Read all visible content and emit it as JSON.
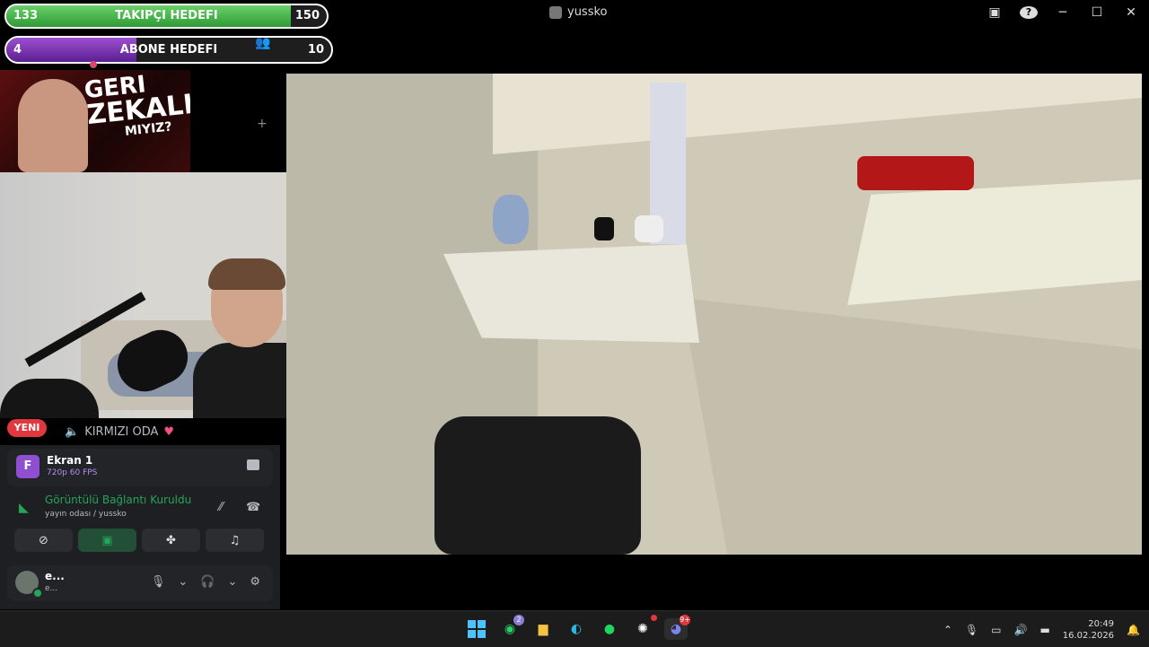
{
  "goals": {
    "followers": {
      "start": "133",
      "title": "TAKIPÇI HEDEFI",
      "end": "150",
      "progress": 0.887
    },
    "subs": {
      "start": "4",
      "title": "ABONE HEDEFI",
      "end": "10",
      "progress": 0.4
    }
  },
  "titlebar": {
    "username": "yussko"
  },
  "thumbnail": {
    "line1": "GERI",
    "line2": "ZEKALI",
    "line3": "MIYIZ?"
  },
  "sidebar": {
    "new_badge": "YENI",
    "voice_channel": "KIRMIZI ODA",
    "heart": "♥"
  },
  "screenshare": {
    "app_letter": "F",
    "title": "Ekran 1",
    "meta": "720p 60 FPS"
  },
  "connection": {
    "status": "Görüntülü Bağlantı Kuruldu",
    "location": "yayın odası / yussko"
  },
  "user": {
    "name": "e...",
    "status": "e..."
  },
  "taskbar": {
    "whatsapp_badge": "2",
    "discord_badge": "9+",
    "time": "20:49",
    "date": "16.02.2026"
  },
  "colors": {
    "followers_bar": "#3aa845",
    "subs_bar": "#7a36b8",
    "discord_green": "#23a55a",
    "badge_red": "#e0383e"
  }
}
